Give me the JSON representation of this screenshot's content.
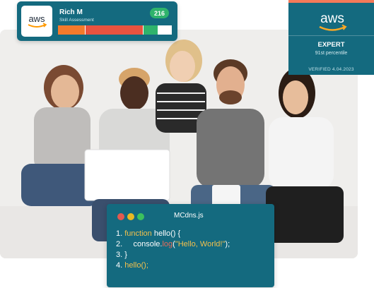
{
  "skill_card": {
    "logo_text": "aws",
    "name": "Rich M",
    "subtitle": "Skill Assessment",
    "score": "216",
    "progress_segments": [
      {
        "color": "#f47a2b",
        "fraction": 0.24
      },
      {
        "color": "#e8533f",
        "fraction": 0.51
      },
      {
        "color": "#2fb36c",
        "fraction": 0.13
      },
      {
        "color": "#ffffff",
        "fraction": 0.12
      }
    ]
  },
  "cert_card": {
    "logo_text": "aws",
    "level": "EXPERT",
    "percentile": "91st percentile",
    "verified": "VERIFIED 4.04.2023"
  },
  "code_card": {
    "file_name": "MCdns.js",
    "lines": [
      {
        "num": "1.",
        "keyword": "function",
        "rest": " hello() {"
      },
      {
        "num": "2.",
        "indent": "     ",
        "pre": "console.",
        "method": "log",
        "open": "(",
        "string": "\"Hello, World!\"",
        "close": ")",
        "end": ";"
      },
      {
        "num": "3.",
        "text": "}"
      },
      {
        "num": "4.",
        "call": "hello();"
      }
    ]
  },
  "colors": {
    "card_teal": "#146a7f",
    "accent_orange": "#f47a59",
    "code_yellow": "#f2c04d"
  }
}
